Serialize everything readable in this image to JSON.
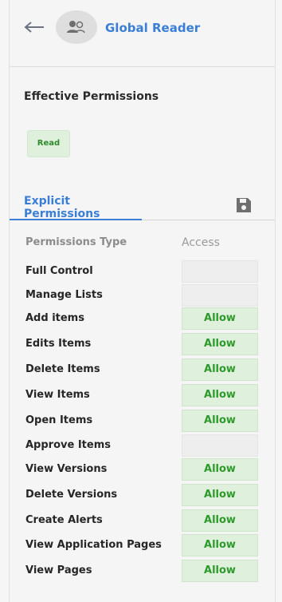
{
  "header": {
    "title": "Global Reader"
  },
  "effective": {
    "heading": "Effective Permissions",
    "badges": [
      "Read"
    ]
  },
  "tabs": [
    {
      "label": "Explicit Permissions"
    }
  ],
  "table": {
    "columns": [
      "Permissions Type",
      "Access"
    ],
    "rows": [
      {
        "type": "Full Control",
        "access": ""
      },
      {
        "type": "Manage Lists",
        "access": ""
      },
      {
        "type": "Add items",
        "access": "Allow"
      },
      {
        "type": "Edits Items",
        "access": "Allow"
      },
      {
        "type": "Delete Items",
        "access": "Allow"
      },
      {
        "type": "View Items",
        "access": "Allow"
      },
      {
        "type": "Open Items",
        "access": "Allow"
      },
      {
        "type": "Approve Items",
        "access": ""
      },
      {
        "type": "View Versions",
        "access": "Allow"
      },
      {
        "type": "Delete Versions",
        "access": "Allow"
      },
      {
        "type": "Create Alerts",
        "access": "Allow"
      },
      {
        "type": "View Application Pages",
        "access": "Allow"
      },
      {
        "type": "View Pages",
        "access": "Allow"
      }
    ]
  },
  "icons": {
    "back": "arrow-left-icon",
    "avatar": "group-users-icon",
    "save": "floppy-disk-icon"
  },
  "colors": {
    "accent": "#3a7fd5",
    "allow_bg": "#dff0dc",
    "allow_text": "#2e9a2b"
  }
}
